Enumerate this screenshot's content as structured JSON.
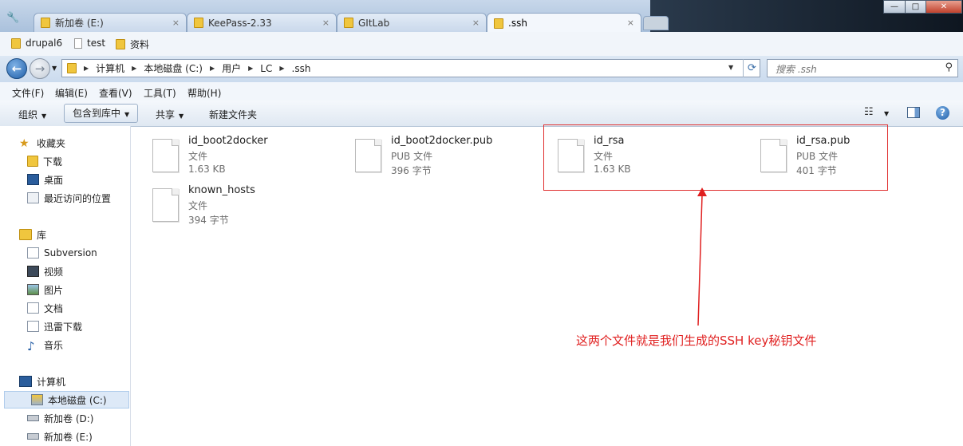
{
  "tabs": [
    {
      "label": "新加卷 (E:)"
    },
    {
      "label": "KeePass-2.33"
    },
    {
      "label": "GItLab"
    },
    {
      "label": ".ssh"
    }
  ],
  "tab_close_glyph": "×",
  "window_buttons": {
    "minimize": "—",
    "maximize": "□",
    "close": "✕"
  },
  "bookmarks": [
    {
      "label": "drupal6",
      "icon": "folder-icon"
    },
    {
      "label": "test",
      "icon": "file-icon"
    },
    {
      "label": "资料",
      "icon": "folder-icon"
    }
  ],
  "address": {
    "crumbs": [
      "计算机",
      "本地磁盘 (C:)",
      "用户",
      "LC",
      ".ssh"
    ]
  },
  "search": {
    "placeholder": "搜索 .ssh"
  },
  "menu": [
    "文件(F)",
    "编辑(E)",
    "查看(V)",
    "工具(T)",
    "帮助(H)"
  ],
  "commands": {
    "organize": "组织",
    "include_library": "包含到库中",
    "share": "共享",
    "new_folder": "新建文件夹"
  },
  "sidebar": {
    "favorites": {
      "label": "收藏夹",
      "items": [
        "下载",
        "桌面",
        "最近访问的位置"
      ]
    },
    "libraries": {
      "label": "库",
      "items": [
        "Subversion",
        "视频",
        "图片",
        "文档",
        "迅雷下载",
        "音乐"
      ]
    },
    "computer": {
      "label": "计算机",
      "items": [
        "本地磁盘 (C:)",
        "新加卷 (D:)",
        "新加卷 (E:)"
      ]
    }
  },
  "files": [
    {
      "name": "id_boot2docker",
      "type": "文件",
      "size": "1.63 KB"
    },
    {
      "name": "id_boot2docker.pub",
      "type": "PUB 文件",
      "size": "396 字节"
    },
    {
      "name": "id_rsa",
      "type": "文件",
      "size": "1.63 KB"
    },
    {
      "name": "id_rsa.pub",
      "type": "PUB 文件",
      "size": "401 字节"
    },
    {
      "name": "known_hosts",
      "type": "文件",
      "size": "394 字节"
    }
  ],
  "annotation": "这两个文件就是我们生成的SSH key秘钥文件",
  "colors": {
    "annotation": "#e02020",
    "accent": "#1f5ea8"
  }
}
